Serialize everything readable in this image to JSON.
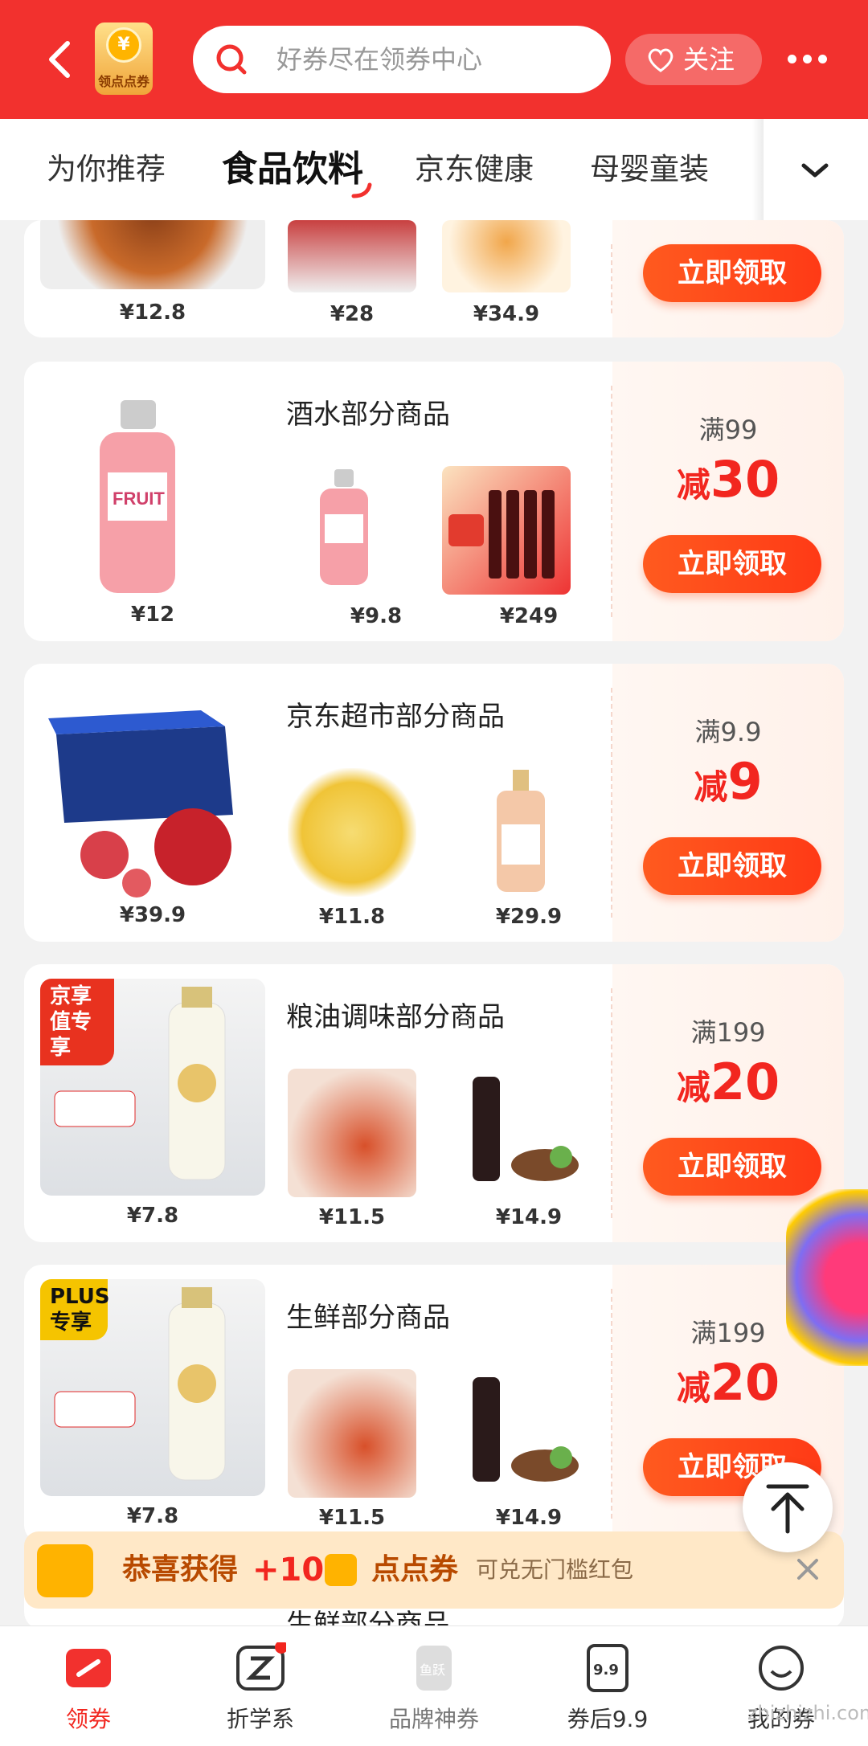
{
  "header": {
    "shop_badge": "领点点券",
    "coin_symbol": "¥",
    "search_placeholder": "好券尽在领券中心",
    "follow_label": "关注"
  },
  "tabs": [
    {
      "label": "为你推荐"
    },
    {
      "label": "食品饮料"
    },
    {
      "label": "京东健康"
    },
    {
      "label": "母婴童装"
    }
  ],
  "cards": [
    {
      "name": "",
      "main_price": "¥12.8",
      "prices": [
        "¥28",
        "¥34.9"
      ],
      "cta": "立即领取"
    },
    {
      "name": "酒水部分商品",
      "main_price": "¥12",
      "prices": [
        "¥9.8",
        "¥249"
      ],
      "cond": "满99",
      "pre": "减",
      "amount": "30",
      "cta": "立即领取"
    },
    {
      "name": "京东超市部分商品",
      "main_price": "¥39.9",
      "prices": [
        "¥11.8",
        "¥29.9"
      ],
      "cond": "满9.9",
      "pre": "减",
      "amount": "9",
      "cta": "立即领取"
    },
    {
      "name": "粮油调味部分商品",
      "badge": "京享值专享",
      "main_price": "¥7.8",
      "prices": [
        "¥11.5",
        "¥14.9"
      ],
      "cond": "满199",
      "pre": "减",
      "amount": "20",
      "cta": "立即领取"
    },
    {
      "name": "生鲜部分商品",
      "badge": "PLUS专享",
      "main_price": "¥7.8",
      "prices": [
        "¥11.5",
        "¥14.9"
      ],
      "cond": "满199",
      "pre": "减",
      "amount": "20",
      "cta": "立即领取"
    },
    {
      "name": "生鲜部分商品"
    }
  ],
  "promo": {
    "text1": "恭喜获得",
    "plus": "+10",
    "text2": "点点券",
    "sub": "可兑无门槛红包"
  },
  "tabbar": [
    {
      "label": "领券"
    },
    {
      "label": "折学系"
    },
    {
      "label": "品牌神券",
      "icon_text": "鱼跃"
    },
    {
      "label": "券后9.9",
      "icon_text": "9.9"
    },
    {
      "label": "我的券"
    }
  ],
  "watermark": "zhizhizhi.com",
  "colors": {
    "brand_red": "#f2312e",
    "cta_orange": "#ff4a1c",
    "amount_red": "#f2261f"
  }
}
